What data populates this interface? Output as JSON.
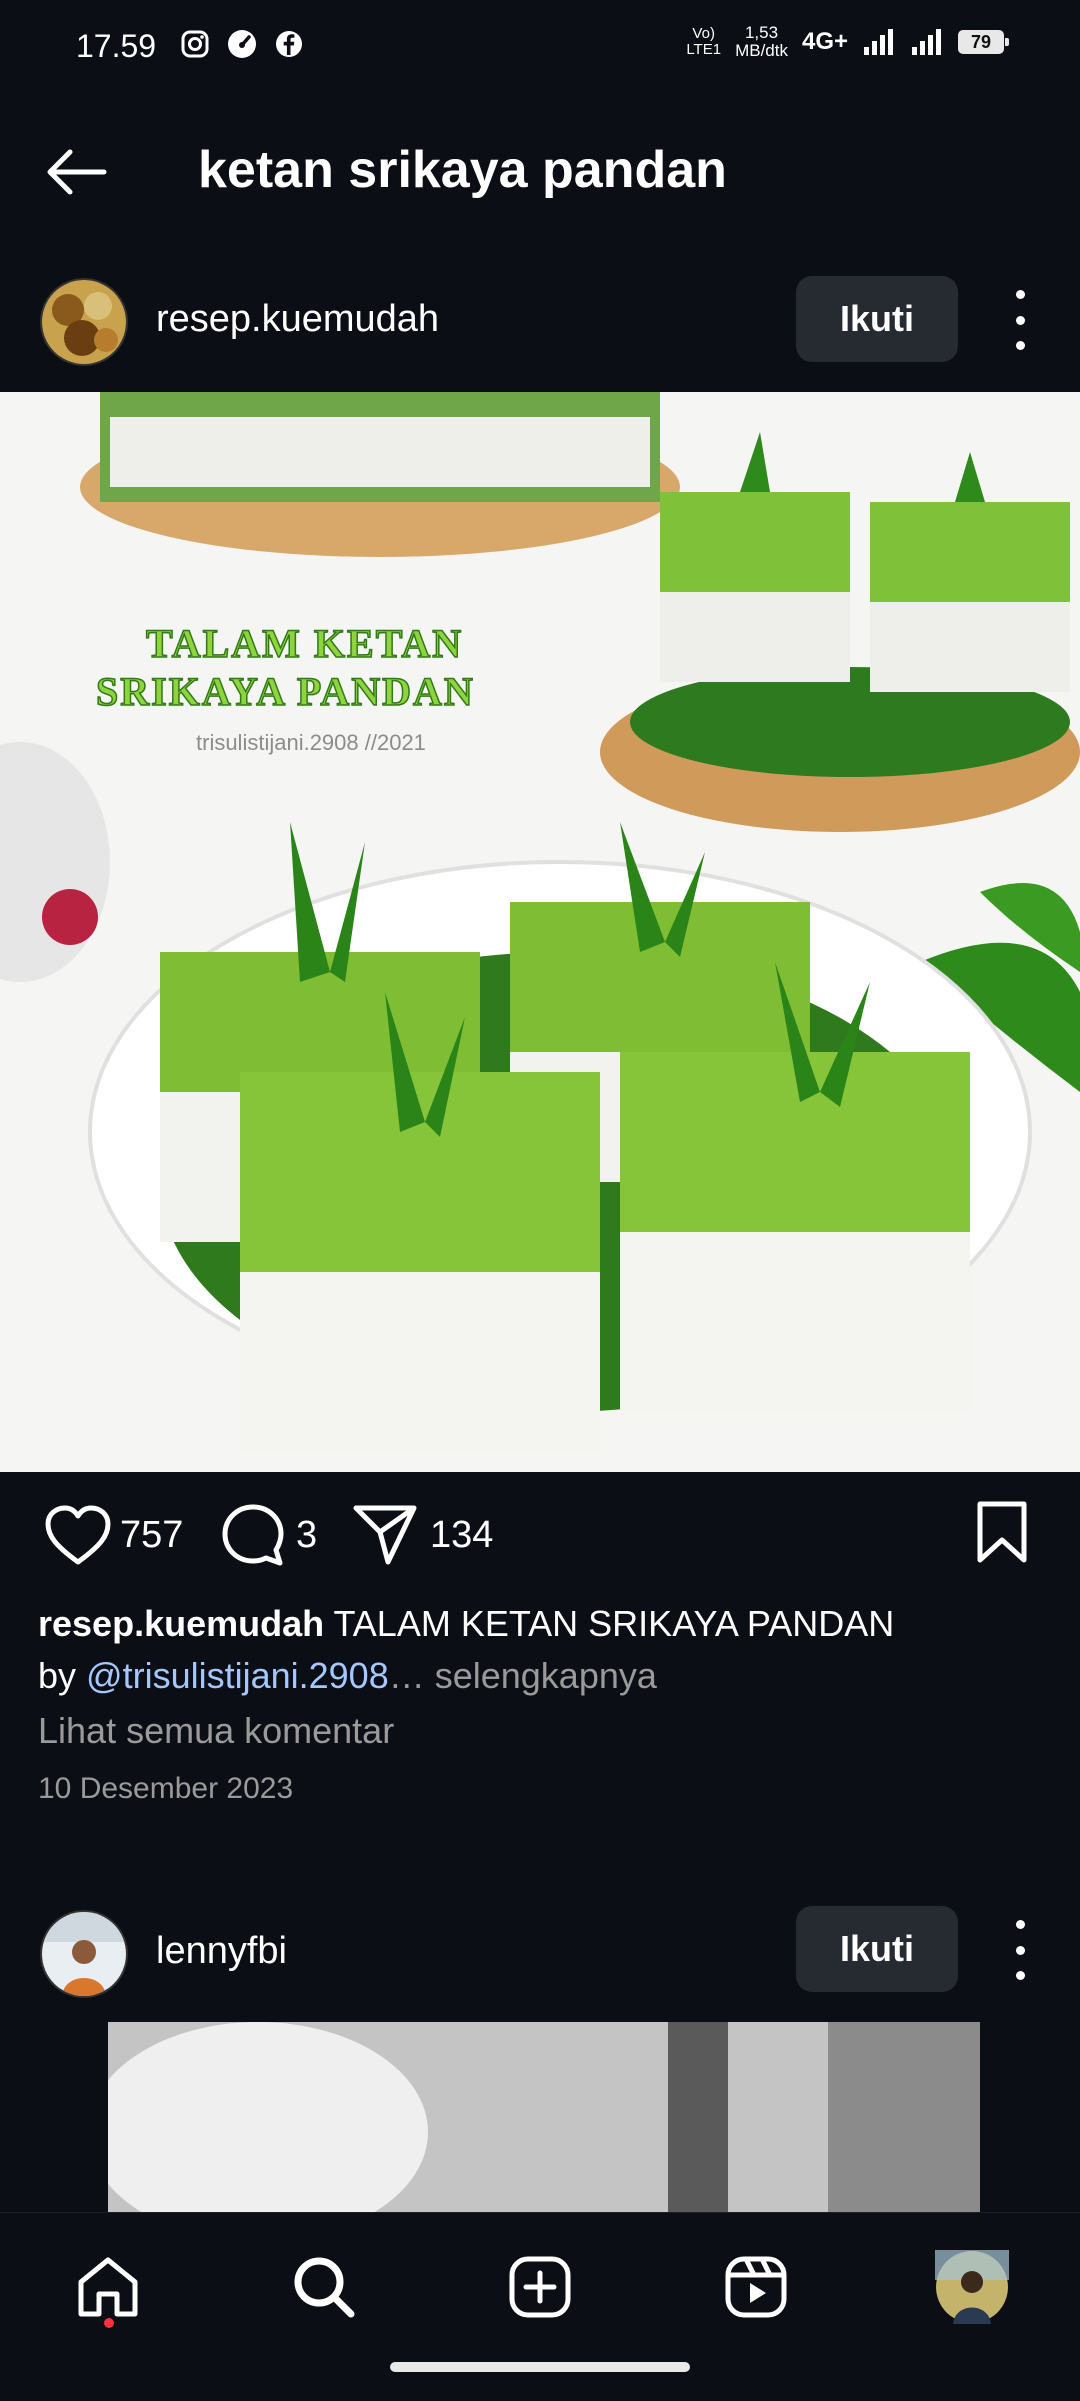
{
  "status_bar": {
    "time": "17.59",
    "volte_top": "Vo)",
    "volte_bottom": "LTE1",
    "speed_top": "1,53",
    "speed_bottom": "MB/dtk",
    "network": "4G+",
    "battery": "79",
    "app_icons": [
      "instagram-icon",
      "speed-icon",
      "facebook-icon"
    ]
  },
  "header": {
    "title": "ketan srikaya pandan"
  },
  "post1": {
    "username": "resep.kuemudah",
    "follow_label": "Ikuti",
    "image": {
      "overlay_line1": "TALAM KETAN",
      "overlay_line2": "SRIKAYA PANDAN",
      "overlay_credit": "trisulistijani.2908 //2021"
    },
    "likes": "757",
    "comments": "3",
    "shares": "134",
    "caption_user": "resep.kuemudah",
    "caption_text": " TALAM KETAN SRIKAYA PANDAN",
    "caption_by": "by ",
    "caption_mention": "@trisulistijani.2908",
    "caption_more": "… selengkapnya",
    "view_comments": "Lihat semua komentar",
    "date": "10 Desember 2023"
  },
  "post2": {
    "username": "lennyfbi",
    "follow_label": "Ikuti"
  },
  "bottom_nav": {
    "items": [
      "home-icon",
      "search-icon",
      "create-icon",
      "reels-icon",
      "profile-avatar"
    ]
  },
  "colors": {
    "background": "#0b0e14",
    "follow_button": "#262a31",
    "mention": "#a5c7ff",
    "muted": "#9a9a9a",
    "notification_dot": "#ff3040"
  }
}
